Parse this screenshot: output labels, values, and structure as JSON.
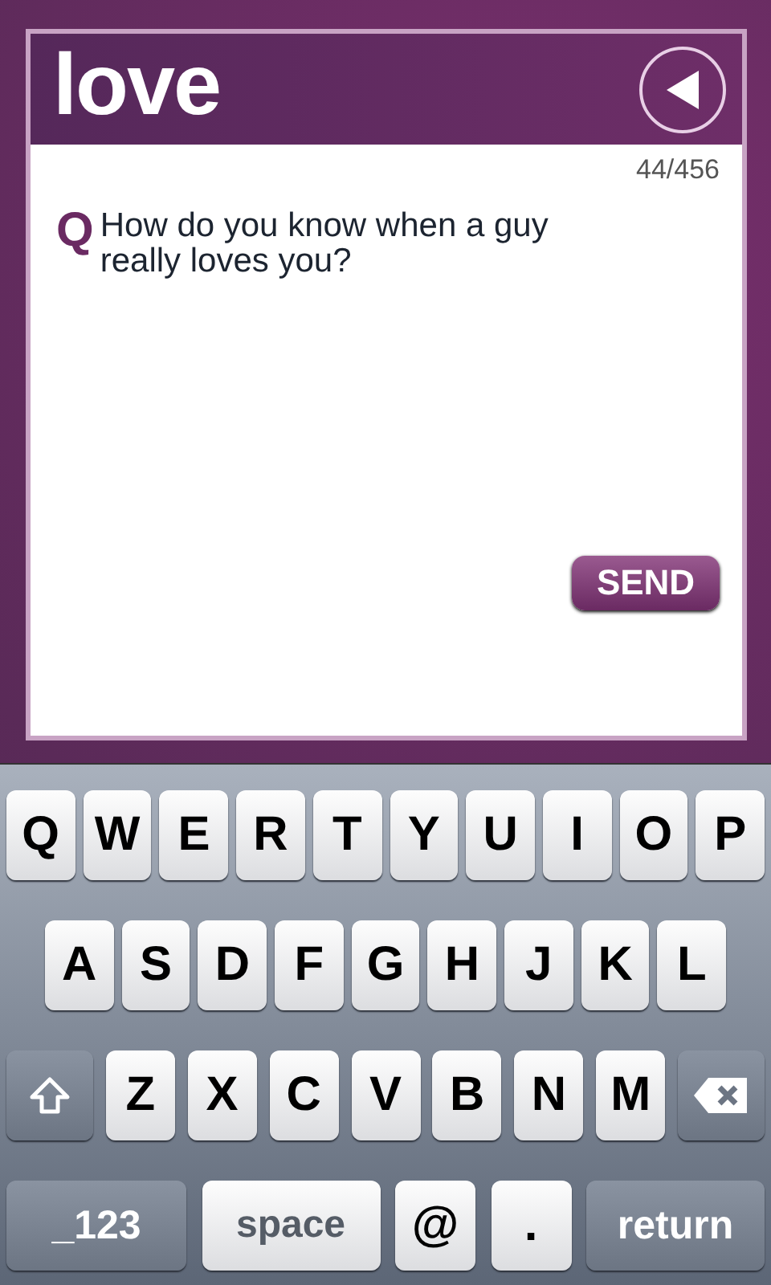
{
  "header": {
    "title": "love"
  },
  "counter": "44/456",
  "question": {
    "mark": "Q",
    "text": "How do you know when a guy really loves you?"
  },
  "send_button": "SEND",
  "keyboard": {
    "letter_row_top": [
      {
        "kind": "letter",
        "label": "Q"
      },
      {
        "kind": "letter",
        "label": "W"
      },
      {
        "kind": "letter",
        "label": "E"
      },
      {
        "kind": "letter",
        "label": "R"
      },
      {
        "kind": "letter",
        "label": "T"
      },
      {
        "kind": "letter",
        "label": "Y"
      },
      {
        "kind": "letter",
        "label": "U"
      },
      {
        "kind": "letter",
        "label": "I"
      },
      {
        "kind": "letter",
        "label": "O"
      },
      {
        "kind": "letter",
        "label": "P"
      }
    ],
    "letter_row_middle": [
      {
        "kind": "letter",
        "label": "A"
      },
      {
        "kind": "letter",
        "label": "S"
      },
      {
        "kind": "letter",
        "label": "D"
      },
      {
        "kind": "letter",
        "label": "F"
      },
      {
        "kind": "letter",
        "label": "G"
      },
      {
        "kind": "letter",
        "label": "H"
      },
      {
        "kind": "letter",
        "label": "J"
      },
      {
        "kind": "letter",
        "label": "K"
      },
      {
        "kind": "letter",
        "label": "L"
      }
    ],
    "letter_row_bottom": [
      {
        "kind": "shift"
      },
      {
        "kind": "letter",
        "label": "Z"
      },
      {
        "kind": "letter",
        "label": "X"
      },
      {
        "kind": "letter",
        "label": "C"
      },
      {
        "kind": "letter",
        "label": "V"
      },
      {
        "kind": "letter",
        "label": "B"
      },
      {
        "kind": "letter",
        "label": "N"
      },
      {
        "kind": "letter",
        "label": "M"
      },
      {
        "kind": "backspace"
      }
    ],
    "function_row": [
      {
        "kind": "numbers",
        "label": "_123"
      },
      {
        "kind": "space",
        "label": "space"
      },
      {
        "kind": "symbol",
        "label": "@"
      },
      {
        "kind": "symbol",
        "label": "."
      },
      {
        "kind": "return",
        "label": "return"
      }
    ]
  }
}
